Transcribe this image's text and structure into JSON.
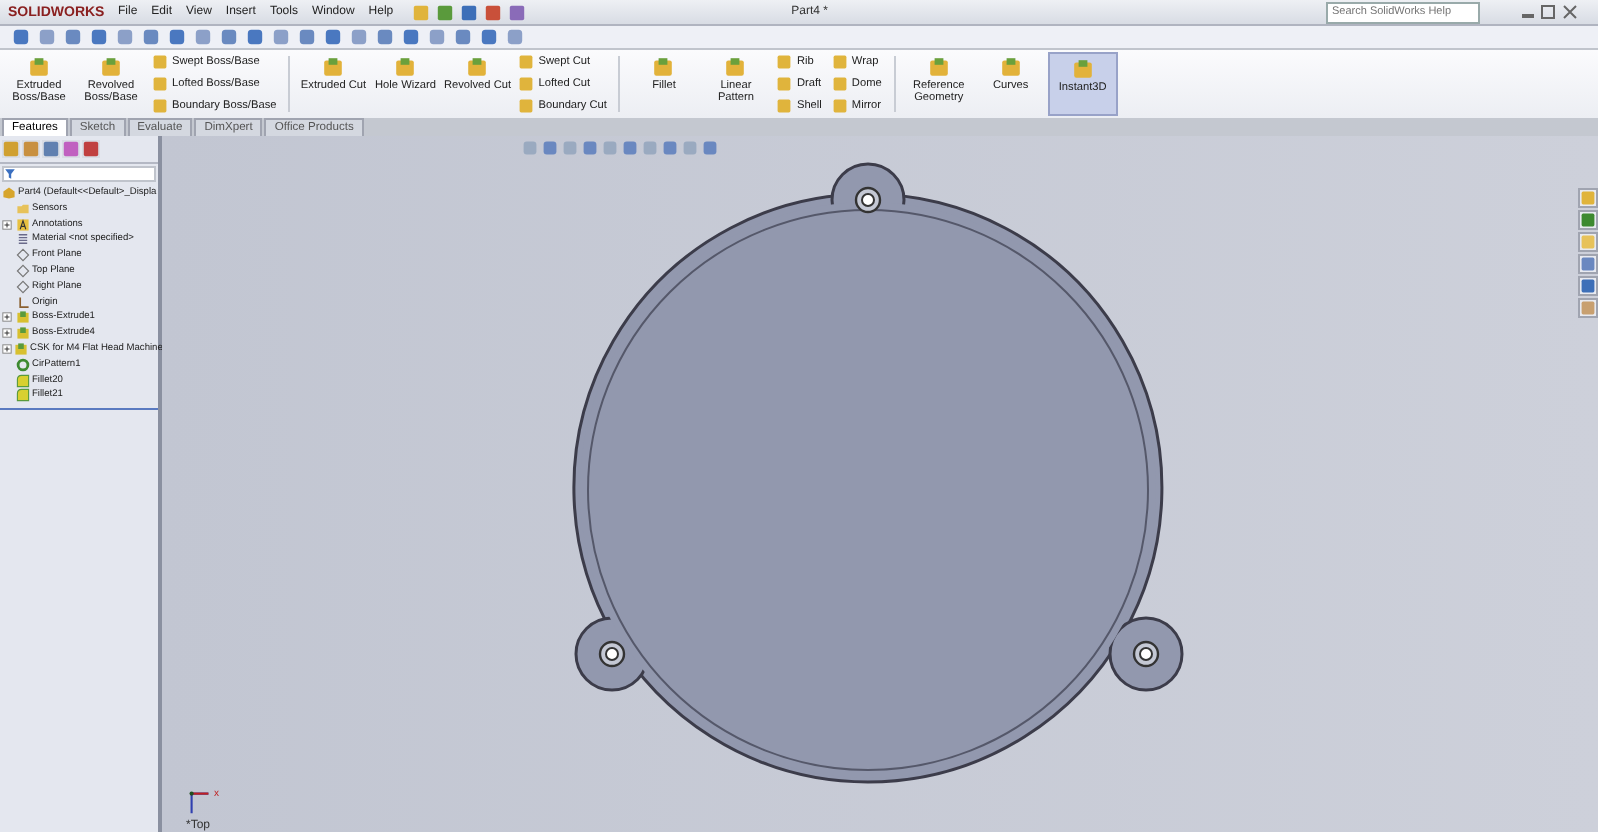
{
  "app": {
    "logo": "SOLIDWORKS",
    "menus": [
      "File",
      "Edit",
      "View",
      "Insert",
      "Tools",
      "Window",
      "Help"
    ],
    "title": "Part4 *",
    "search": {
      "placeholder": "Search SolidWorks Help"
    }
  },
  "command_groups": [
    {
      "kind": "large",
      "items": [
        {
          "label": "Extruded Boss/Base",
          "selected": false
        },
        {
          "label": "Revolved Boss/Base",
          "selected": false
        }
      ]
    },
    {
      "kind": "stack",
      "items": [
        {
          "label": "Swept Boss/Base"
        },
        {
          "label": "Lofted Boss/Base"
        },
        {
          "label": "Boundary Boss/Base"
        }
      ]
    },
    {
      "kind": "separator"
    },
    {
      "kind": "large",
      "items": [
        {
          "label": "Extruded Cut",
          "selected": false
        },
        {
          "label": "Hole Wizard",
          "selected": false
        },
        {
          "label": "Revolved Cut",
          "selected": false
        }
      ]
    },
    {
      "kind": "stack",
      "items": [
        {
          "label": "Swept Cut"
        },
        {
          "label": "Lofted Cut"
        },
        {
          "label": "Boundary Cut"
        }
      ]
    },
    {
      "kind": "separator"
    },
    {
      "kind": "large",
      "items": [
        {
          "label": "Fillet",
          "selected": false
        },
        {
          "label": "Linear Pattern",
          "selected": false
        }
      ]
    },
    {
      "kind": "stack",
      "items": [
        {
          "label": "Rib"
        },
        {
          "label": "Draft"
        },
        {
          "label": "Shell"
        }
      ]
    },
    {
      "kind": "stack",
      "items": [
        {
          "label": "Wrap"
        },
        {
          "label": "Dome"
        },
        {
          "label": "Mirror"
        }
      ]
    },
    {
      "kind": "separator"
    },
    {
      "kind": "large",
      "items": [
        {
          "label": "Reference Geometry",
          "selected": false
        },
        {
          "label": "Curves",
          "selected": false
        },
        {
          "label": "Instant3D",
          "selected": true
        }
      ]
    }
  ],
  "tabs": [
    {
      "label": "Features",
      "selected": true
    },
    {
      "label": "Sketch",
      "selected": false
    },
    {
      "label": "Evaluate",
      "selected": false
    },
    {
      "label": "DimXpert",
      "selected": false
    },
    {
      "label": "Office Products",
      "selected": false
    }
  ],
  "feature_tree": {
    "root": "Part4  (Default<<Default>_Displa",
    "items": [
      {
        "label": "Sensors",
        "kind": "folder",
        "expandable": false
      },
      {
        "label": "Annotations",
        "kind": "annotation",
        "expandable": true
      },
      {
        "label": "Material <not specified>",
        "kind": "material",
        "expandable": false
      },
      {
        "label": "Front Plane",
        "kind": "plane",
        "expandable": false
      },
      {
        "label": "Top Plane",
        "kind": "plane",
        "expandable": false
      },
      {
        "label": "Right Plane",
        "kind": "plane",
        "expandable": false
      },
      {
        "label": "Origin",
        "kind": "origin",
        "expandable": false
      },
      {
        "label": "Boss-Extrude1",
        "kind": "feature",
        "expandable": true
      },
      {
        "label": "Boss-Extrude4",
        "kind": "feature",
        "expandable": true
      },
      {
        "label": "CSK for M4 Flat Head Machine",
        "kind": "feature",
        "expandable": true
      },
      {
        "label": "CirPattern1",
        "kind": "pattern",
        "expandable": false
      },
      {
        "label": "Fillet20",
        "kind": "fillet",
        "expandable": false
      },
      {
        "label": "Fillet21",
        "kind": "fillet",
        "expandable": false
      }
    ]
  },
  "viewport": {
    "view_label": "*Top",
    "axis_label": "x"
  }
}
